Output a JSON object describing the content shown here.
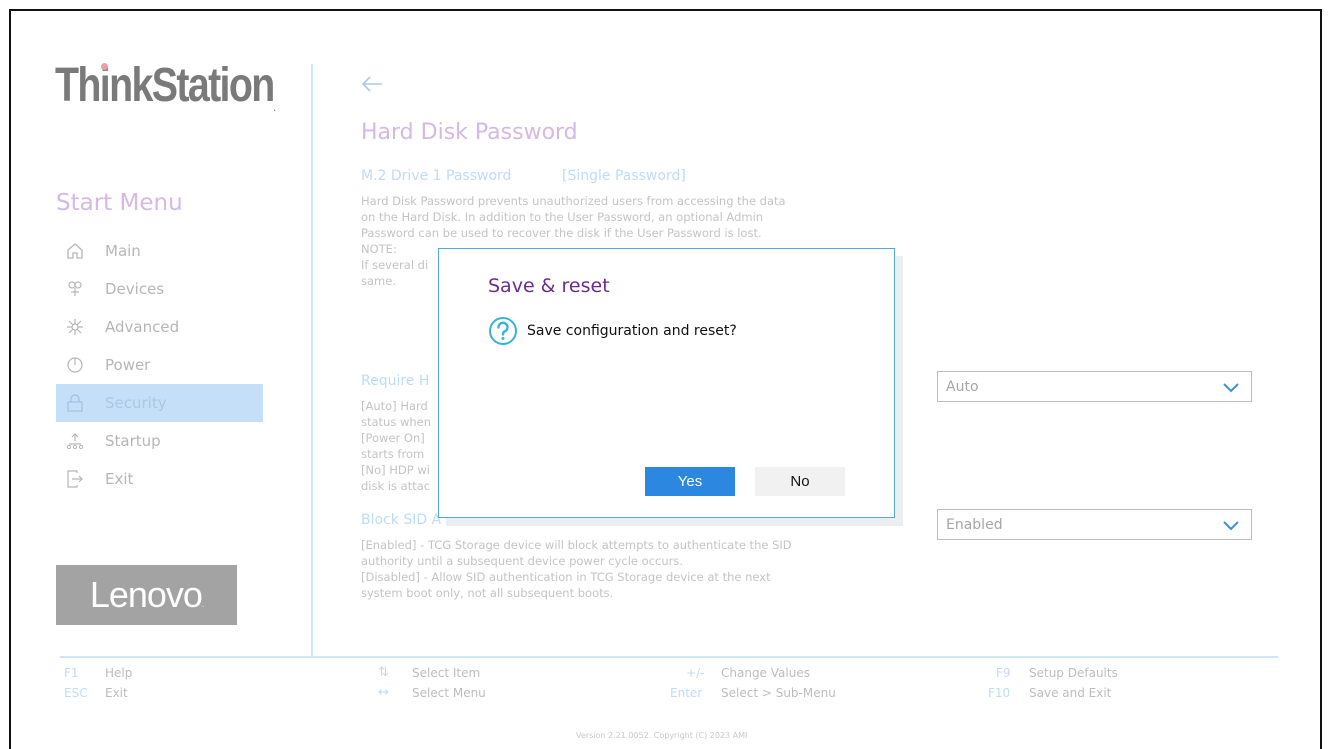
{
  "sidebar": {
    "brand": "ThinkStation",
    "start_menu_title": "Start Menu",
    "items": [
      {
        "label": "Main",
        "icon": "home-icon"
      },
      {
        "label": "Devices",
        "icon": "devices-icon"
      },
      {
        "label": "Advanced",
        "icon": "advanced-icon"
      },
      {
        "label": "Power",
        "icon": "power-icon"
      },
      {
        "label": "Security",
        "icon": "lock-icon",
        "active": true
      },
      {
        "label": "Startup",
        "icon": "startup-icon"
      },
      {
        "label": "Exit",
        "icon": "exit-icon"
      }
    ],
    "vendor_logo": "Lenovo"
  },
  "content": {
    "page_title": "Hard Disk Password",
    "drive_label": "M.2 Drive 1 Password",
    "drive_value": "[Single Password]",
    "description_lines": [
      "Hard Disk Password prevents unauthorized users from accessing the data",
      "on the Hard Disk. In addition to the User Password, an optional Admin",
      "Password can be used to recover the disk if the User Password is lost.",
      "NOTE:",
      "If several di",
      "same."
    ],
    "require_label": "Require H",
    "require_lines": [
      "[Auto] Hard",
      "status when",
      "[Power On] ",
      "starts from ",
      "[No] HDP wi",
      "disk is attac"
    ],
    "require_select_value": "Auto",
    "block_sid_label": "Block SID A",
    "block_sid_lines": [
      "[Enabled] - TCG Storage device will block attempts to authenticate the SID",
      "authority until a subsequent device power cycle occurs.",
      "[Disabled] - Allow SID authentication in TCG Storage device at the next",
      "system boot only, not all subsequent boots."
    ],
    "block_sid_select_value": "Enabled"
  },
  "footer": {
    "f1_key": "F1",
    "f1_desc": "Help",
    "esc_key": "ESC",
    "esc_desc": "Exit",
    "select_item_key": "⇅",
    "select_item_desc": "Select Item",
    "select_menu_key": "↔",
    "select_menu_desc": "Select Menu",
    "change_key": "+/-",
    "change_desc": "Change Values",
    "enter_key": "Enter",
    "enter_desc": "Select > Sub-Menu",
    "f9_key": "F9",
    "f9_desc": "Setup Defaults",
    "f10_key": "F10",
    "f10_desc": "Save and Exit",
    "version": "Version 2.21.0052. Copyright (C) 2023 AMI"
  },
  "dialog": {
    "title": "Save & reset",
    "message": "Save configuration and reset?",
    "icon": "question-icon",
    "yes_label": "Yes",
    "no_label": "No"
  },
  "colors": {
    "accent_blue": "#2b87df",
    "active_item_bg": "#c4dff7",
    "dialog_title": "#6a2c91"
  }
}
